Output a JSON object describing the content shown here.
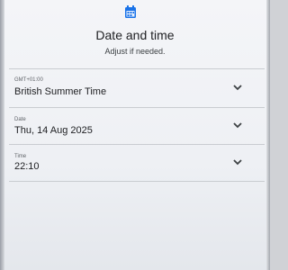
{
  "header": {
    "icon": "calendar-icon",
    "title": "Date and time",
    "subtitle": "Adjust if needed."
  },
  "fields": [
    {
      "label": "GMT+01:00",
      "value": "British Summer Time"
    },
    {
      "label": "Date",
      "value": "Thu, 14 Aug 2025"
    },
    {
      "label": "Time",
      "value": "22:10"
    }
  ],
  "colors": {
    "accent": "#1a73e8",
    "text": "#202124",
    "secondary_text": "#5f6368"
  }
}
